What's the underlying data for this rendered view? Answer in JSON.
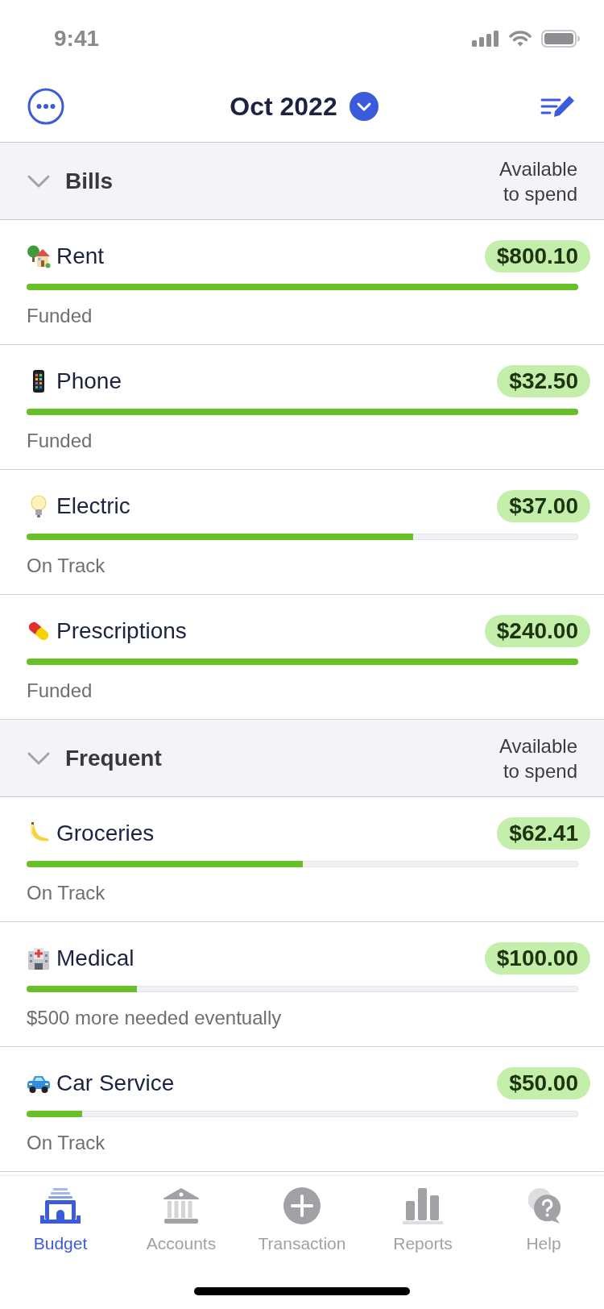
{
  "status_bar": {
    "time": "9:41"
  },
  "header": {
    "title": "Oct 2022"
  },
  "groups": [
    {
      "name": "Bills",
      "expanded": true,
      "column_label": "Available to spend",
      "rows": [
        {
          "name": "Rent",
          "amount": "$800.10",
          "level": 1,
          "status": "Funded"
        },
        {
          "name": "Phone",
          "amount": "$32.50",
          "level": 1,
          "status": "Funded"
        },
        {
          "name": "Electric",
          "amount": "$37.00",
          "level": 0.7,
          "status": "On Track"
        },
        {
          "name": "Prescriptions",
          "amount": "$240.00",
          "level": 1,
          "status": "Funded"
        }
      ]
    },
    {
      "name": "Frequent",
      "expanded": true,
      "column_label": "Available to spend",
      "rows": [
        {
          "name": "Groceries",
          "amount": "$62.41",
          "level": 0.5,
          "status": "On Track"
        },
        {
          "name": "Medical",
          "amount": "$100.00",
          "level": 0.2,
          "status": "$500 more needed eventually"
        },
        {
          "name": "Car Service",
          "amount": "$50.00",
          "level": 0.1,
          "status": "On Track"
        }
      ]
    }
  ],
  "tabs": [
    {
      "label": "Budget",
      "selected": true
    },
    {
      "label": "Accounts",
      "selected": false
    },
    {
      "label": "Transaction",
      "selected": false
    },
    {
      "label": "Reports",
      "selected": false
    },
    {
      "label": "Help",
      "selected": false
    }
  ]
}
